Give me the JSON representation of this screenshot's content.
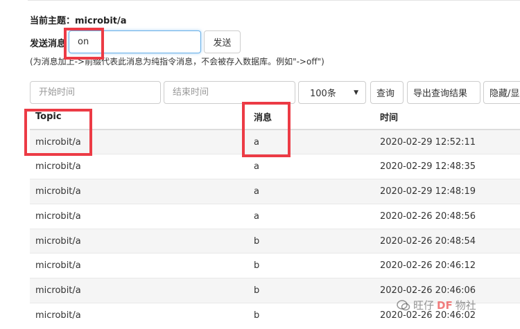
{
  "header": {
    "topic_text": "当前主题：microbit/a",
    "send_label": "发送消息"
  },
  "send": {
    "input_value": "on",
    "button_label": "发送",
    "hint": "(为消息加上->前缀代表此消息为纯指令消息，不会被存入数据库。例如\"->off\")"
  },
  "query": {
    "start_placeholder": "开始时间",
    "end_placeholder": "结束时间",
    "count_value": "100条",
    "query_label": "查询",
    "export_label": "导出查询结果",
    "toggle_label": "隐藏/显示"
  },
  "table": {
    "headers": [
      "Topic",
      "消息",
      "时间"
    ],
    "rows": [
      {
        "topic": "microbit/a",
        "message": "a",
        "time": "2020-02-29 12:52:11"
      },
      {
        "topic": "microbit/a",
        "message": "a",
        "time": "2020-02-29 12:48:35"
      },
      {
        "topic": "microbit/a",
        "message": "a",
        "time": "2020-02-29 12:48:19"
      },
      {
        "topic": "microbit/a",
        "message": "a",
        "time": "2020-02-26 20:48:56"
      },
      {
        "topic": "microbit/a",
        "message": "b",
        "time": "2020-02-26 20:48:54"
      },
      {
        "topic": "microbit/a",
        "message": "b",
        "time": "2020-02-26 20:46:12"
      },
      {
        "topic": "microbit/a",
        "message": "b",
        "time": "2020-02-26 20:46:06"
      },
      {
        "topic": "microbit/a",
        "message": "b",
        "time": "2020-02-26 20:46:02"
      }
    ]
  },
  "watermark": {
    "text_before": "旺仔",
    "text_df": "DF",
    "text_after": "物社"
  },
  "colors": {
    "highlight_box": "#ec3b45",
    "focus_border": "#66afe9",
    "stripe": "#f5f5f5"
  }
}
